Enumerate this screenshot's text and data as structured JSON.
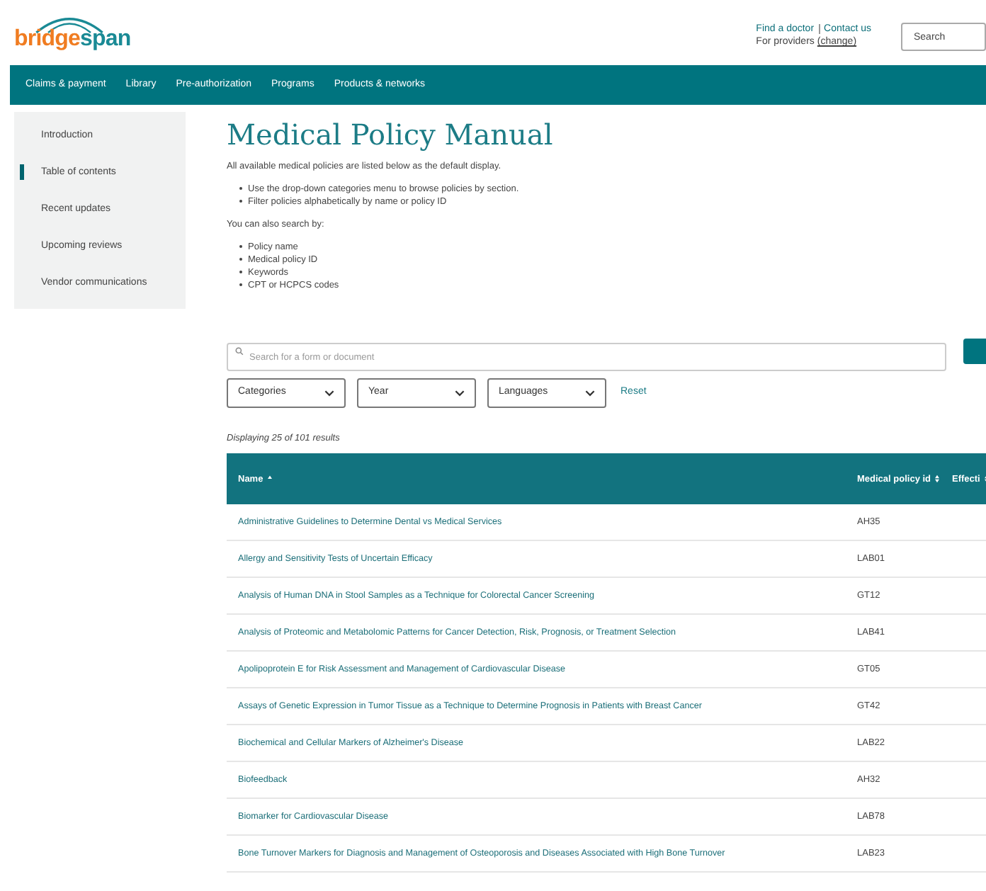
{
  "header": {
    "logo": {
      "first": "bridge",
      "second": "span"
    },
    "links": [
      "Find a doctor",
      "Contact us"
    ],
    "providers": {
      "text": "For providers",
      "link": "(change)"
    },
    "search": {
      "placeholder": "Search"
    }
  },
  "nav": [
    "Claims & payment",
    "Library",
    "Pre-authorization",
    "Programs",
    "Products & networks"
  ],
  "sidebar": {
    "items": [
      {
        "label": "Introduction",
        "selected": false
      },
      {
        "label": "Table of contents",
        "selected": true
      },
      {
        "label": "Recent updates",
        "selected": false
      },
      {
        "label": "Upcoming reviews",
        "selected": false
      },
      {
        "label": "Vendor communications",
        "selected": false
      }
    ]
  },
  "title": "Medical Policy Manual",
  "intro": "All available medical policies are listed below as the default display.",
  "intro_bullets": [
    "Use the drop-down categories menu to browse policies by section.",
    "Filter policies alphabetically by name or policy ID"
  ],
  "search_by_label": "You can also search by:",
  "search_by": [
    "Policy name",
    "Medical policy ID",
    "Keywords",
    "CPT or HCPCS codes"
  ],
  "search_field": {
    "placeholder": "Search for a form or document"
  },
  "filters": [
    "Categories",
    "Year",
    "Languages"
  ],
  "reset": "Reset",
  "results_count": "Displaying 25 of 101 results",
  "table": {
    "columns": [
      "Name",
      "Medical policy id",
      "Effecti"
    ],
    "rows": [
      {
        "name": "Administrative Guidelines to Determine Dental vs Medical Services",
        "id": "AH35"
      },
      {
        "name": "Allergy and Sensitivity Tests of Uncertain Efficacy",
        "id": "LAB01"
      },
      {
        "name": "Analysis of Human DNA in Stool Samples as a Technique for Colorectal Cancer Screening",
        "id": "GT12"
      },
      {
        "name": "Analysis of Proteomic and Metabolomic Patterns for Cancer Detection, Risk, Prognosis, or Treatment Selection",
        "id": "LAB41"
      },
      {
        "name": "Apolipoprotein E for Risk Assessment and Management of Cardiovascular Disease",
        "id": "GT05"
      },
      {
        "name": "Assays of Genetic Expression in Tumor Tissue as a Technique to Determine Prognosis in Patients with Breast Cancer",
        "id": "GT42"
      },
      {
        "name": "Biochemical and Cellular Markers of Alzheimer's Disease",
        "id": "LAB22"
      },
      {
        "name": "Biofeedback",
        "id": "AH32"
      },
      {
        "name": "Biomarker for Cardiovascular Disease",
        "id": "LAB78"
      },
      {
        "name": "Bone Turnover Markers for Diagnosis and Management of Osteoporosis and Diseases Associated with High Bone Turnover",
        "id": "LAB23"
      }
    ]
  }
}
